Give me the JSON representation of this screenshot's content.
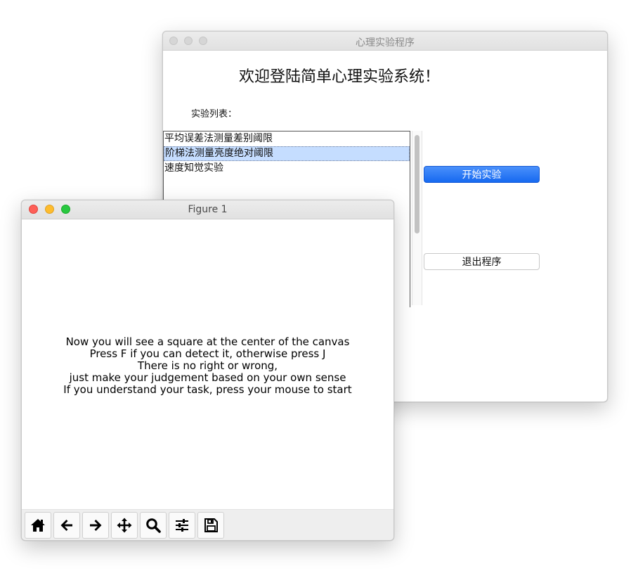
{
  "app_window": {
    "title": "心理实验程序",
    "heading": "欢迎登陆简单心理实验系统！",
    "list_label": "实验列表：",
    "experiments": [
      "平均误差法测量差别阈限",
      "阶梯法测量亮度绝对阈限",
      "速度知觉实验"
    ],
    "selected_index": 1,
    "start_button": "开始实验",
    "quit_button": "退出程序",
    "colors": {
      "selection": "#c5ddff",
      "primary_button": "#1669f0"
    }
  },
  "figure_window": {
    "title": "Figure 1",
    "instructions": [
      "Now you will see a square at the center of the canvas",
      "Press F if you can detect it, otherwise press J",
      "There is no right or wrong,",
      "just make your judgement based on your own sense",
      "If you understand your task, press your mouse to start"
    ],
    "toolbar": [
      "home-icon",
      "back-arrow-icon",
      "forward-arrow-icon",
      "pan-icon",
      "zoom-icon",
      "configure-subplots-icon",
      "save-icon"
    ],
    "traffic_lights": {
      "close": "#fe5f57",
      "minimize": "#febc2e",
      "zoom": "#28c840"
    }
  }
}
